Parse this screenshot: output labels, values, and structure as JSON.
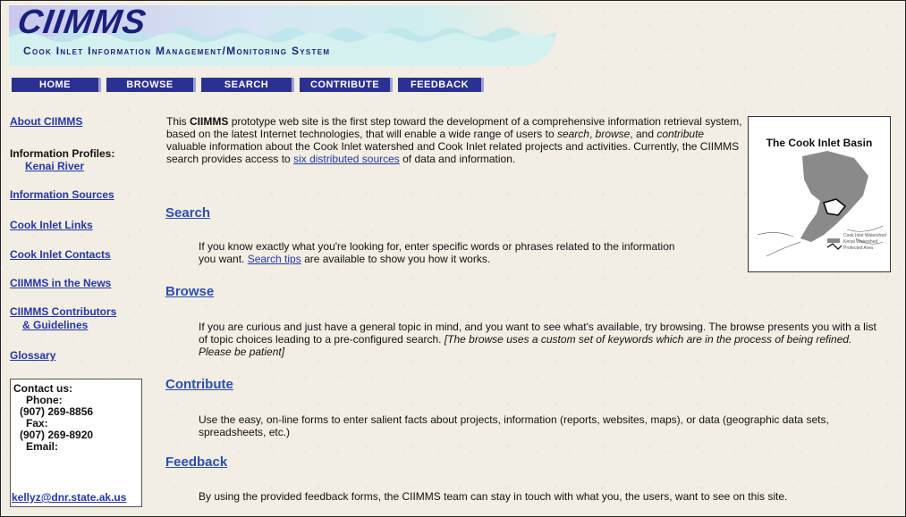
{
  "header": {
    "logo": "CIIMMS",
    "tagline": "Cook Inlet Information Management/Monitoring System"
  },
  "nav": [
    {
      "label": "HOME"
    },
    {
      "label": "BROWSE"
    },
    {
      "label": "SEARCH"
    },
    {
      "label": "CONTRIBUTE"
    },
    {
      "label": "FEEDBACK"
    }
  ],
  "sidebar": {
    "about": "About CIIMMS",
    "profiles_label": "Information Profiles:",
    "kenai": "Kenai River",
    "sources": "Information Sources",
    "links": "Cook Inlet Links",
    "contacts": "Cook Inlet Contacts",
    "news": "CIIMMS in the News",
    "contributors_1": "CIIMMS Contributors",
    "contributors_2": "& Guidelines",
    "glossary": "Glossary"
  },
  "contact": {
    "title": "Contact us:",
    "phone_label": "Phone:",
    "phone": "(907) 269-8856",
    "fax_label": "Fax:",
    "fax": "(907) 269-8920",
    "email_label": "Email:",
    "email": "kellyz@dnr.state.ak.us"
  },
  "intro": {
    "p1": "This ",
    "bold": "CIIMMS",
    "p2": " prototype web site is the first step toward the development of a comprehensive information retrieval system, based on the latest Internet technologies, that will enable a wide range of users to ",
    "search_em": "search",
    "p3": ", ",
    "browse_em": "browse",
    "p4": ", and ",
    "contribute_em": "contribute",
    "p5": " valuable information about the Cook Inlet watershed and Cook Inlet related projects and activities. Currently, the CIIMMS search provides access to ",
    "link": "six distributed sources",
    "p6": " of data and information."
  },
  "sections": {
    "search": {
      "title": "Search",
      "t1": "If you know exactly what you're looking for, enter specific words or phrases related to the information you want. ",
      "link": "Search tips",
      "t2": " are available to show you how it works."
    },
    "browse": {
      "title": "Browse",
      "t1": "If you are curious and just have a general topic in mind, and you want to see what's available, try browsing. The browse presents you with a list of topic choices leading to a pre-configured search. ",
      "em": "[The browse uses a custom set of keywords which are in the process of being refined. Please be patient]"
    },
    "contribute": {
      "title": "Contribute",
      "t1": "Use the easy, on-line forms to enter salient facts about projects, information (reports, websites, maps), or data (geographic data sets, spreadsheets, etc.)"
    },
    "feedback": {
      "title": "Feedback",
      "t1": "By using the provided feedback forms, the CIIMMS team can stay in touch with what you, the users, want to see on this site."
    }
  },
  "map": {
    "title": "The Cook Inlet Basin",
    "legend_1": "Cook Inlet Watershed",
    "legend_2": "Kenai Watershed",
    "legend_3": "Protected Area"
  }
}
